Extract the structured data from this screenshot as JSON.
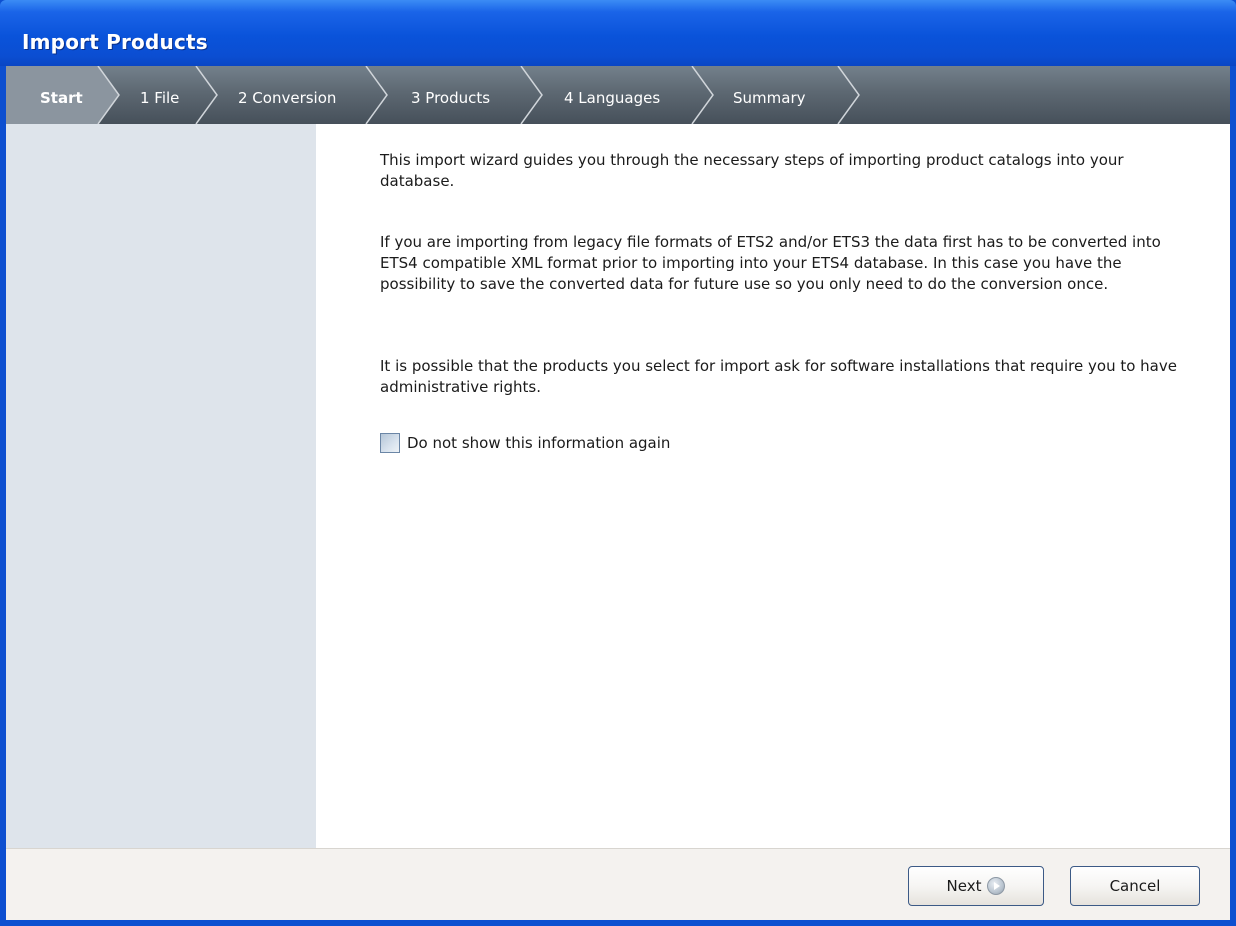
{
  "window": {
    "title": "Import Products"
  },
  "steps": [
    {
      "label": "Start",
      "active": true
    },
    {
      "label": "1 File",
      "active": false
    },
    {
      "label": "2 Conversion",
      "active": false
    },
    {
      "label": "3 Products",
      "active": false
    },
    {
      "label": "4 Languages",
      "active": false
    },
    {
      "label": "Summary",
      "active": false
    }
  ],
  "content": {
    "paragraphs": [
      "This import wizard guides you through the necessary steps of importing product catalogs into your database.",
      "If you are importing from legacy file formats of ETS2 and/or ETS3 the data first has to be converted into ETS4 compatible XML format prior to importing into your ETS4 database. In this case you have the possibility to save the converted data for future use so you only need to do the conversion once.",
      "It is possible that the products you select for import ask for software installations that require you to have administrative rights."
    ],
    "checkbox": {
      "label": "Do not show this information again",
      "checked": false
    }
  },
  "footer": {
    "next_label": "Next",
    "next_icon": "arrow-right-circle-icon",
    "cancel_label": "Cancel"
  },
  "colors": {
    "titlebar": "#0b4ed2",
    "stepbar": "#5d6872",
    "active_step": "#8a949e",
    "sidebar": "#dee4eb",
    "footer": "#f4f2ef"
  }
}
